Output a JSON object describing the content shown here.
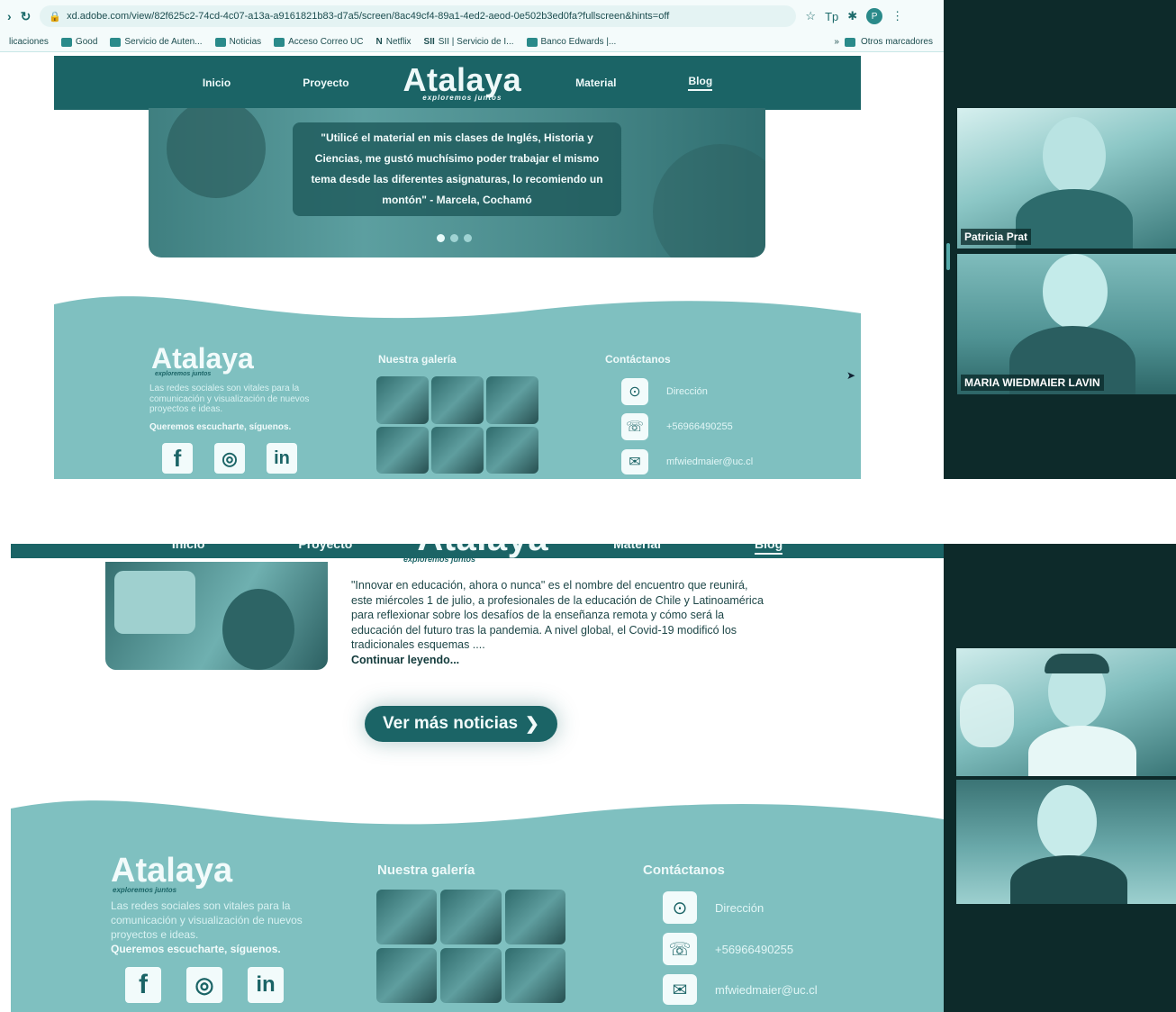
{
  "browser": {
    "url": "xd.adobe.com/view/82f625c2-74cd-4c07-a13a-a9161821b83-d7a5/screen/8ac49cf4-89a1-4ed2-aeod-0e502b3ed0fa?fullscreen&hints=off",
    "profile_initial": "P",
    "bookmarks": [
      {
        "label": "licaciones"
      },
      {
        "label": "Good"
      },
      {
        "label": "Servicio de Auten..."
      },
      {
        "label": "Noticias"
      },
      {
        "label": "Acceso Correo UC"
      },
      {
        "label": "Netflix"
      },
      {
        "label": "SII | Servicio de I..."
      },
      {
        "label": "Banco Edwards |..."
      }
    ],
    "other_bookmarks": "Otros marcadores"
  },
  "site": {
    "nav": {
      "inicio": "Inicio",
      "proyecto": "Proyecto",
      "logo": "Atalaya",
      "tagline": "exploremos juntos",
      "material": "Material",
      "blog": "Blog"
    },
    "hero_quote": "\"Utilicé el material en mis clases de Inglés, Historia y Ciencias, me gustó muchísimo poder trabajar el mismo tema desde las diferentes asignaturas, lo recomiendo un montón\" - Marcela, Cochamó",
    "footer": {
      "logo": "Atalaya",
      "tagline": "exploremos juntos",
      "description": "Las redes sociales son vitales para la comunicación y visualización de nuevos proyectos e ideas.",
      "cta": "Queremos escucharte, síguenos.",
      "gallery_title": "Nuestra galería",
      "contact_title": "Contáctanos",
      "address": "Dirección",
      "phone": "+56966490255",
      "email": "mfwiedmaier@uc.cl"
    },
    "news": {
      "paragraph_lead": "\"Innovar en educación, ahora o nunca\" es el nombre del encuentro que reunirá, este miércoles 1 de julio, a profesionales de la educación de Chile y Latinoamérica para reflexionar sobre los desafíos de la enseñanza remota y cómo será la educación del futuro tras la pandemia. A nivel global, el Covid-19 modificó los tradicionales esquemas ....",
      "read_more": "Continuar leyendo...",
      "more_news_button": "Ver más noticias"
    }
  },
  "participants": [
    {
      "name": "Patricia Prat"
    },
    {
      "name": "MARIA WIEDMAIER LAVIN"
    }
  ],
  "colors": {
    "primary": "#1b6466",
    "footer": "#7fc0c0",
    "panel": "#0d2a2a"
  }
}
